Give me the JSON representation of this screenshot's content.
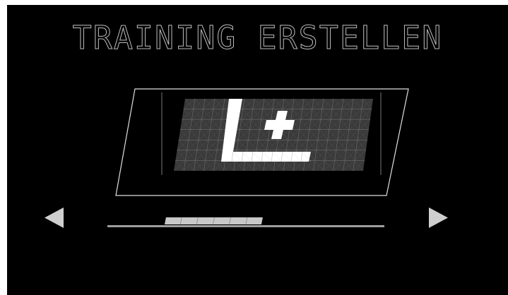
{
  "screen": {
    "title": "TRAINING ERSTELLEN"
  },
  "colors": {
    "background": "#000000",
    "title_outline": "#bdbdbd",
    "frame_line": "#e0e0e0",
    "grid_panel": "#3a3a3a",
    "grid_line": "#6e6e6e",
    "icon_fill": "#ffffff",
    "slider_track": "#9e9e9e",
    "slider_thumb": "#c8c8c8",
    "arrow": "#cfcfcf"
  },
  "card": {
    "icon": "l-plus-icon"
  },
  "carousel": {
    "prev_icon": "triangle-left-icon",
    "next_icon": "triangle-right-icon",
    "position_fraction": 0.32
  }
}
